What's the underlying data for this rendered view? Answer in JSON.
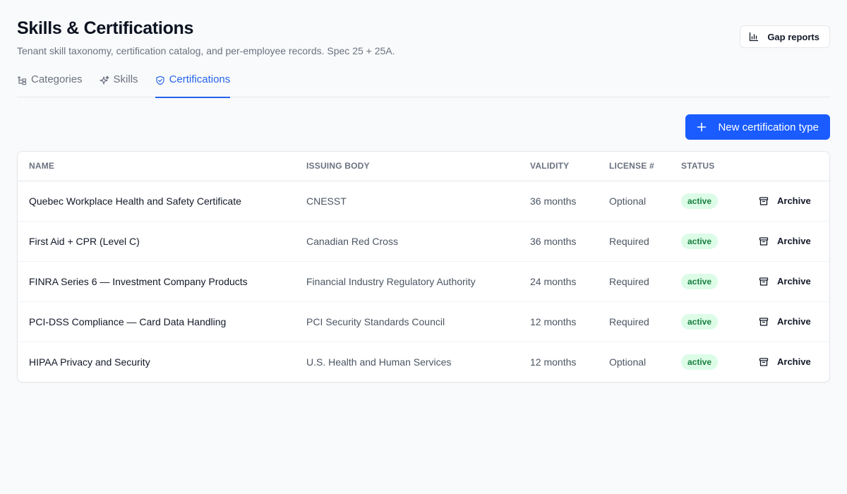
{
  "page": {
    "title": "Skills & Certifications",
    "subtitle": "Tenant skill taxonomy, certification catalog, and per-employee records. Spec 25 + 25A."
  },
  "header": {
    "gap_reports_label": "Gap reports",
    "gap_reports_icon": "bar-chart-icon"
  },
  "tabs": [
    {
      "label": "Categories",
      "icon": "tree-icon",
      "active": false
    },
    {
      "label": "Skills",
      "icon": "sparkles-icon",
      "active": false
    },
    {
      "label": "Certifications",
      "icon": "shield-check-icon",
      "active": true
    }
  ],
  "actions": {
    "new_cert_label": "New certification type"
  },
  "table": {
    "columns": [
      "NAME",
      "ISSUING BODY",
      "VALIDITY",
      "LICENSE #",
      "STATUS"
    ],
    "archive_label": "Archive",
    "rows": [
      {
        "name": "Quebec Workplace Health and Safety Certificate",
        "issuer": "CNESST",
        "validity": "36 months",
        "license": "Optional",
        "status": "active"
      },
      {
        "name": "First Aid + CPR (Level C)",
        "issuer": "Canadian Red Cross",
        "validity": "36 months",
        "license": "Required",
        "status": "active"
      },
      {
        "name": "FINRA Series 6 — Investment Company Products",
        "issuer": "Financial Industry Regulatory Authority",
        "validity": "24 months",
        "license": "Required",
        "status": "active"
      },
      {
        "name": "PCI-DSS Compliance — Card Data Handling",
        "issuer": "PCI Security Standards Council",
        "validity": "12 months",
        "license": "Required",
        "status": "active"
      },
      {
        "name": "HIPAA Privacy and Security",
        "issuer": "U.S. Health and Human Services",
        "validity": "12 months",
        "license": "Optional",
        "status": "active"
      }
    ]
  },
  "colors": {
    "accent": "#2563eb",
    "primary_button": "#1a5cff",
    "badge_bg": "#dcfce7",
    "badge_text": "#15803d"
  }
}
